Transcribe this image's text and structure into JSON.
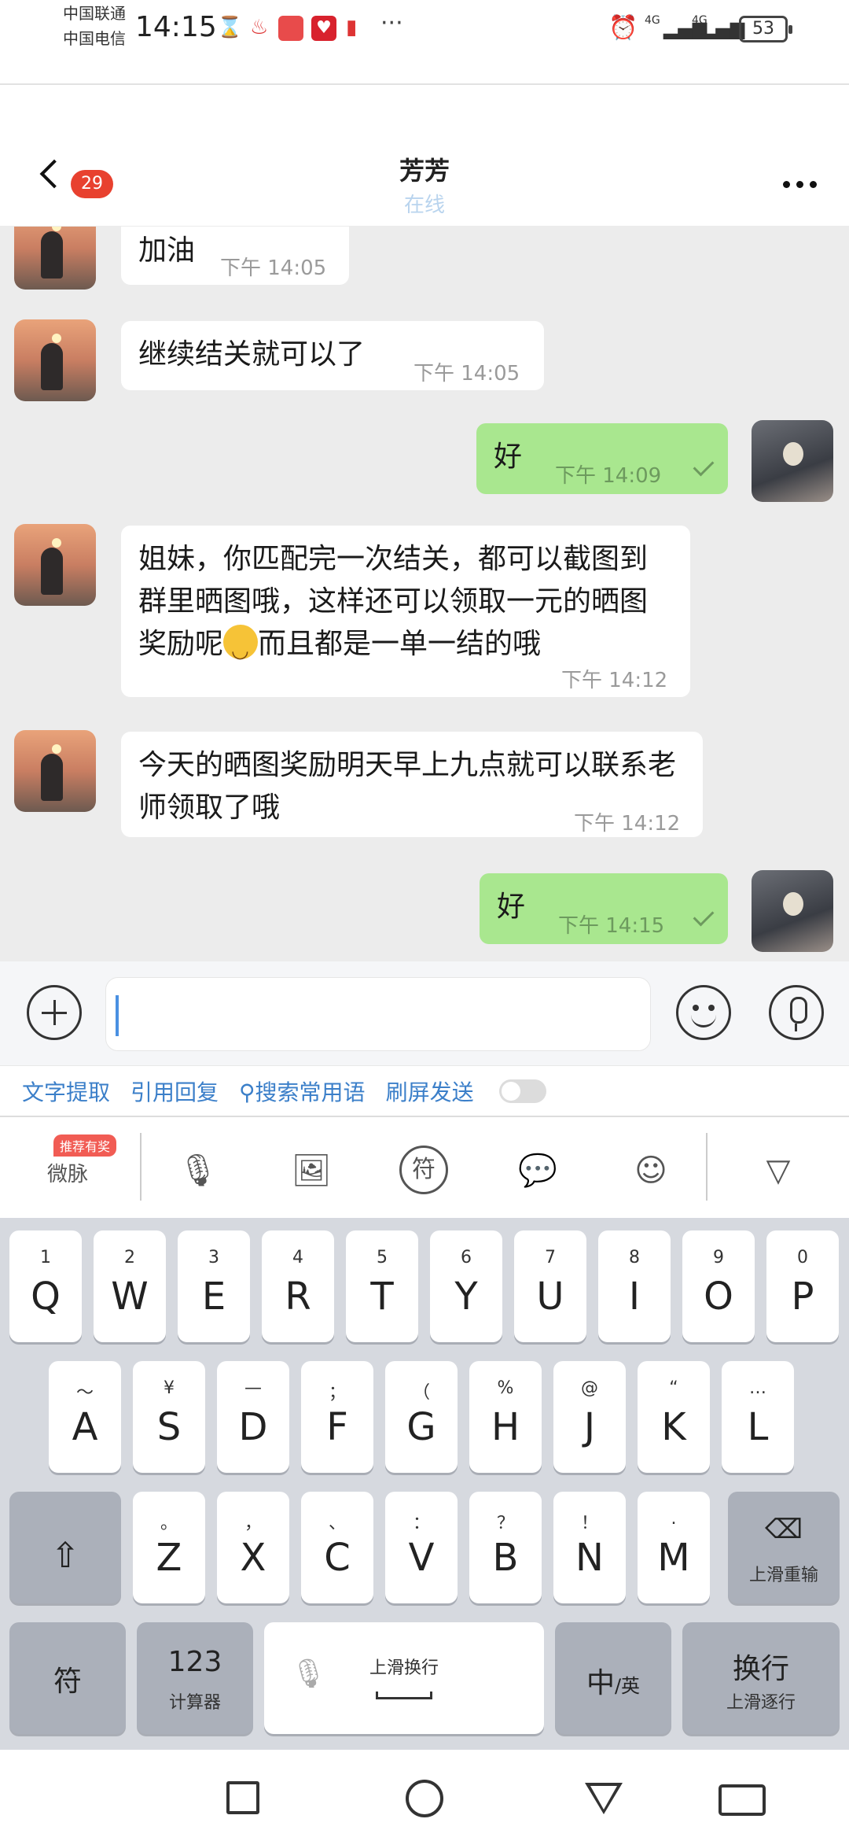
{
  "status_bar": {
    "carrier_1": "中国联通",
    "carrier_2": "中国电信",
    "time": "14:15",
    "network_1": "4G",
    "network_2": "4G",
    "battery": "53"
  },
  "header": {
    "unread_count": "29",
    "contact_name": "芳芳",
    "contact_status": "在线"
  },
  "messages": [
    {
      "side": "left",
      "text": "加油",
      "time": "下午 14:05"
    },
    {
      "side": "left",
      "text": "继续结关就可以了",
      "time": "下午 14:05"
    },
    {
      "side": "right",
      "text": "好",
      "time": "下午 14:09"
    },
    {
      "side": "left",
      "text_part1": "姐妹，你匹配完一次结关，都可以截图到群里晒图哦，这样还可以领取一元的晒图奖励呢",
      "text_part2": "而且都是一单一结的哦",
      "time": "下午 14:12"
    },
    {
      "side": "left",
      "text": "今天的晒图奖励明天早上九点就可以联系老师领取了哦",
      "time": "下午 14:12"
    },
    {
      "side": "right",
      "text": "好",
      "time": "下午 14:15"
    }
  ],
  "quick_actions": [
    "文字提取",
    "引用回复",
    "搜索常用语",
    "刷屏发送"
  ],
  "keyboard_toolbar": {
    "promo_badge": "推荐有奖",
    "weibo_label": "微脉",
    "symbol_label": "符"
  },
  "keyboard": {
    "row1": [
      {
        "main": "Q",
        "sub": "1"
      },
      {
        "main": "W",
        "sub": "2"
      },
      {
        "main": "E",
        "sub": "3"
      },
      {
        "main": "R",
        "sub": "4"
      },
      {
        "main": "T",
        "sub": "5"
      },
      {
        "main": "Y",
        "sub": "6"
      },
      {
        "main": "U",
        "sub": "7"
      },
      {
        "main": "I",
        "sub": "8"
      },
      {
        "main": "O",
        "sub": "9"
      },
      {
        "main": "P",
        "sub": "0"
      }
    ],
    "row2": [
      {
        "main": "A",
        "sub": "～"
      },
      {
        "main": "S",
        "sub": "¥"
      },
      {
        "main": "D",
        "sub": "—"
      },
      {
        "main": "F",
        "sub": "；"
      },
      {
        "main": "G",
        "sub": "（"
      },
      {
        "main": "H",
        "sub": "%"
      },
      {
        "main": "J",
        "sub": "@"
      },
      {
        "main": "K",
        "sub": "“"
      },
      {
        "main": "L",
        "sub": "…"
      }
    ],
    "row3": [
      {
        "main": "Z",
        "sub": "。"
      },
      {
        "main": "X",
        "sub": "，"
      },
      {
        "main": "C",
        "sub": "、"
      },
      {
        "main": "V",
        "sub": "："
      },
      {
        "main": "B",
        "sub": "？"
      },
      {
        "main": "N",
        "sub": "！"
      },
      {
        "main": "M",
        "sub": "."
      }
    ],
    "delete_label": "上滑重输",
    "symbol_key": "符",
    "num_key_main": "123",
    "num_key_sub": "计算器",
    "space_label": "上滑换行",
    "lang_key_main": "中",
    "lang_key_sub": "/英",
    "enter_main": "换行",
    "enter_sub": "上滑逐行"
  },
  "colors": {
    "chat_background": "#ececec",
    "outgoing_bubble": "#a9e78f",
    "incoming_bubble": "#ffffff",
    "unread_badge": "#e8412f",
    "quick_action_text": "#3b7fc9",
    "keyboard_background": "#d6d9df"
  }
}
